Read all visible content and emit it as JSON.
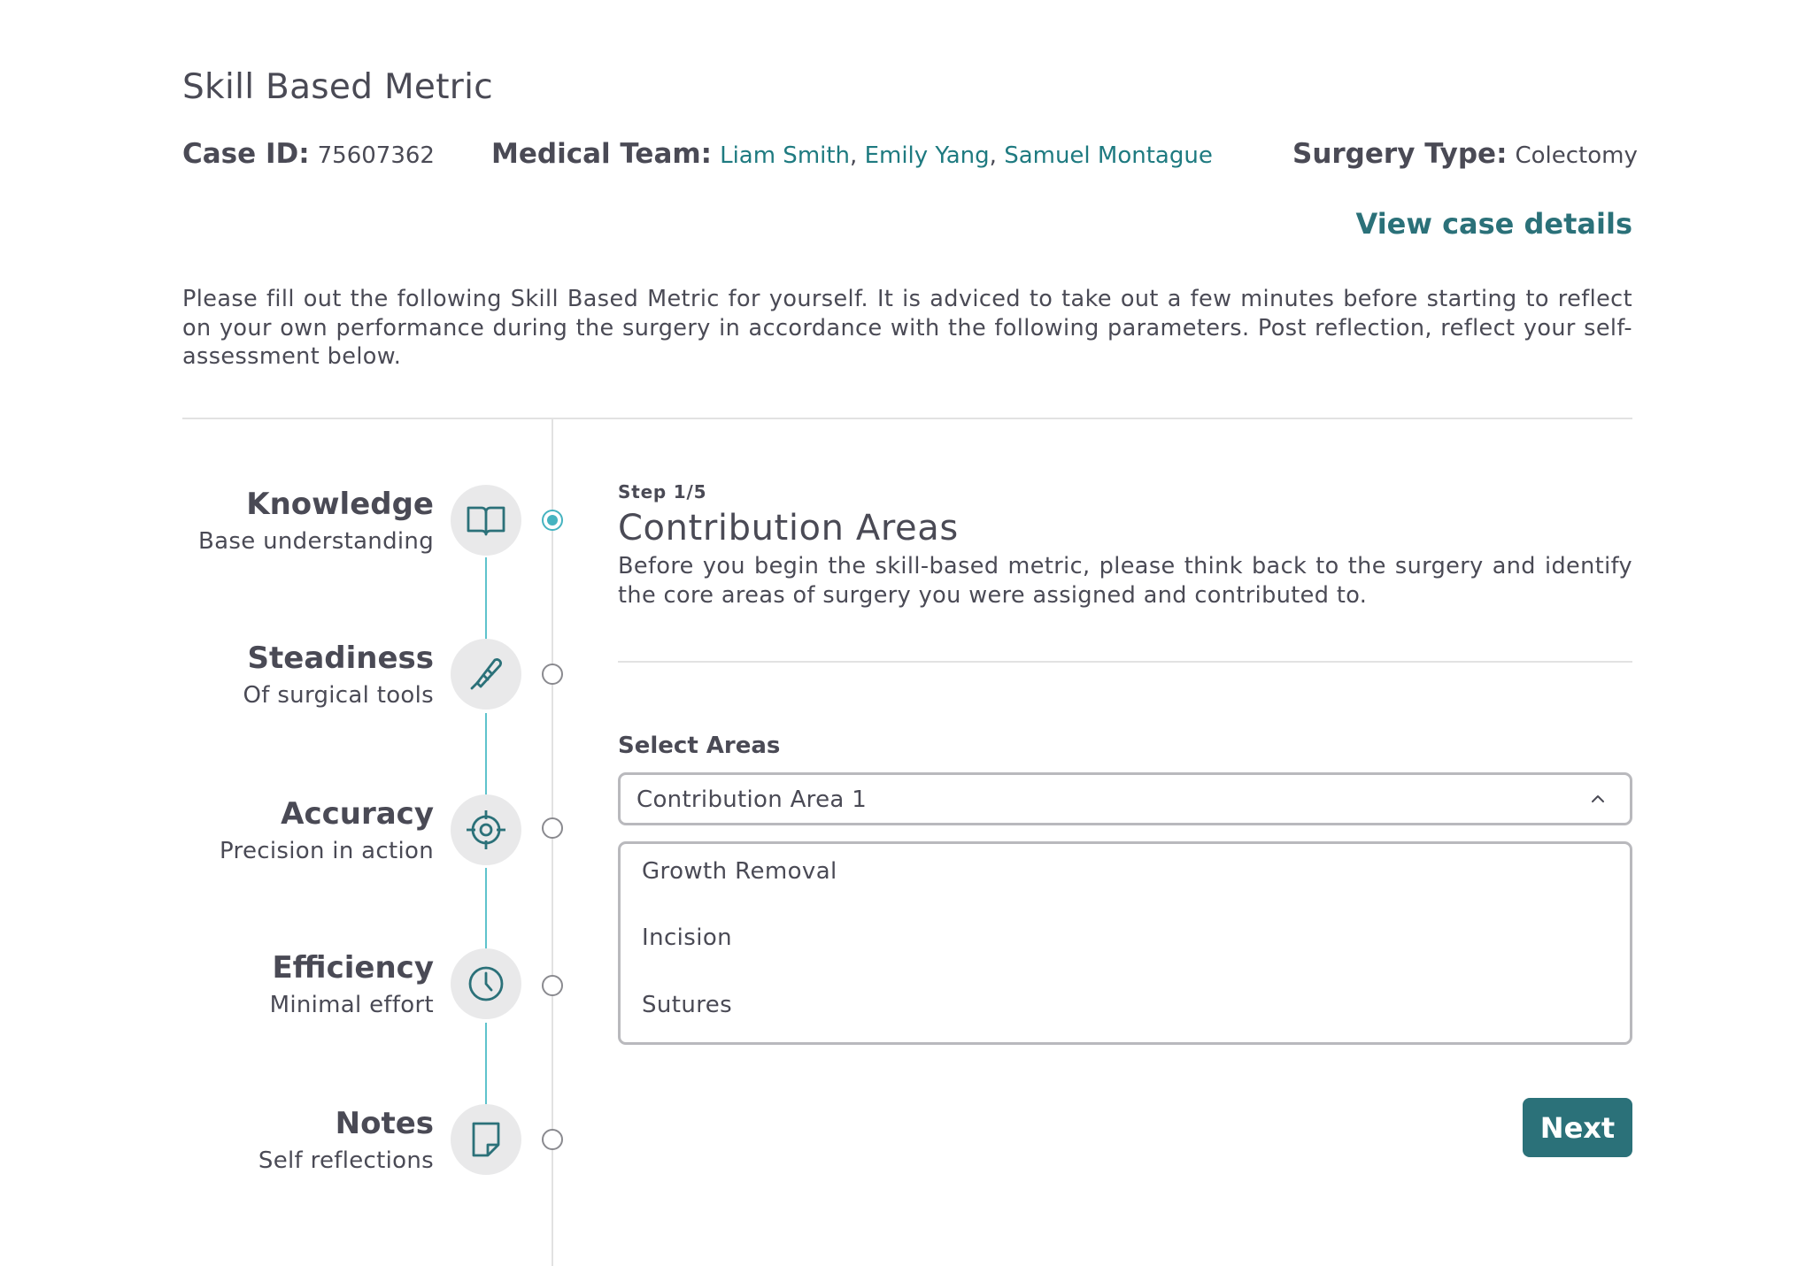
{
  "header": {
    "title": "Skill Based Metric",
    "case_id_label": "Case ID:",
    "case_id": "75607362",
    "team_label": "Medical Team:",
    "team": [
      "Liam Smith",
      "Emily Yang",
      "Samuel Montague"
    ],
    "team_sep": ",",
    "surgery_label": "Surgery Type:",
    "surgery_type": "Colectomy",
    "view_details": "View case details"
  },
  "intro": "Please fill out the following Skill Based Metric for yourself. It is adviced to take out a few minutes before starting to reflect on your own performance during the surgery in accordance with the following parameters. Post reflection, reflect your self-assessment below.",
  "steps": [
    {
      "title": "Knowledge",
      "subtitle": "Base understanding",
      "icon": "book-icon",
      "active": true
    },
    {
      "title": "Steadiness",
      "subtitle": "Of surgical tools",
      "icon": "scalpel-icon",
      "active": false
    },
    {
      "title": "Accuracy",
      "subtitle": "Precision in action",
      "icon": "crosshair-icon",
      "active": false
    },
    {
      "title": "Efficiency",
      "subtitle": "Minimal effort",
      "icon": "clock-icon",
      "active": false
    },
    {
      "title": "Notes",
      "subtitle": "Self reflections",
      "icon": "note-icon",
      "active": false
    }
  ],
  "panel": {
    "step_count": "Step 1/5",
    "title": "Contribution Areas",
    "description": "Before you begin the skill-based metric, please think back to the surgery and identify the core areas of surgery you were assigned and contributed to.",
    "select_label": "Select Areas",
    "select_value": "Contribution Area 1",
    "options": [
      "Growth Removal",
      "Incision",
      "Sutures"
    ],
    "next_label": "Next"
  },
  "colors": {
    "accent": "#2b7179",
    "link": "#1e7a80",
    "timeline": "#5fc3cc",
    "text": "#4a4a55"
  }
}
